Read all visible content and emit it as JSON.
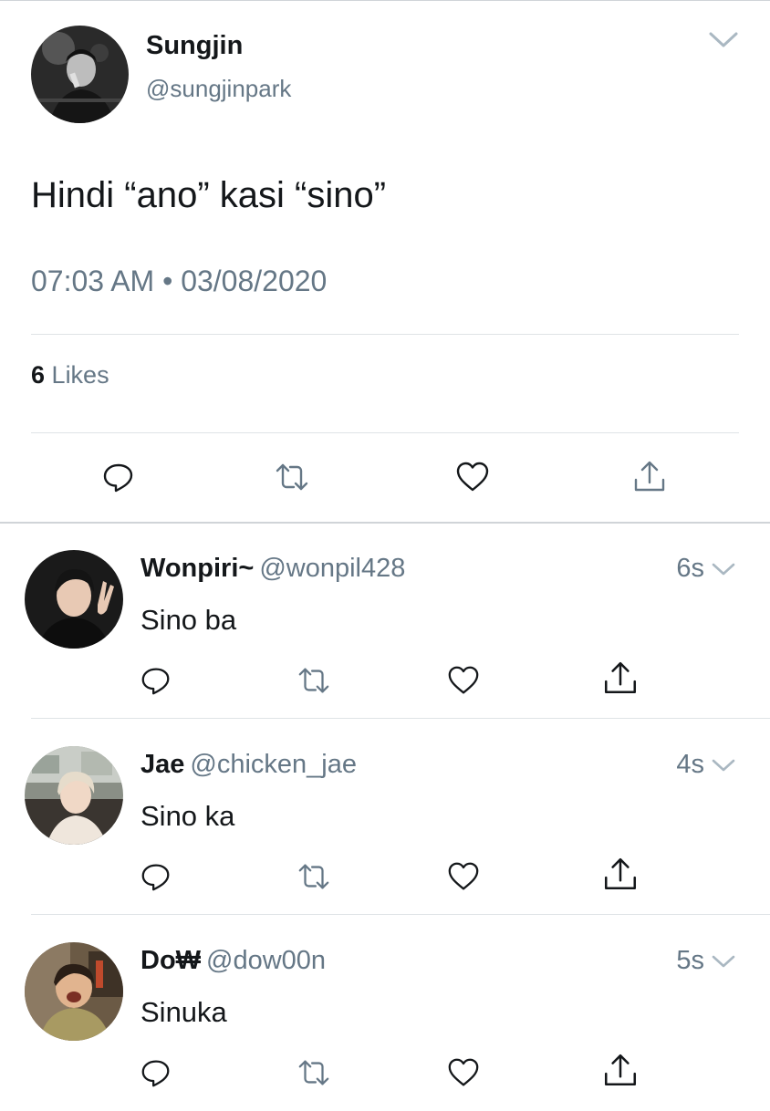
{
  "main_tweet": {
    "name": "Sungjin",
    "handle": "@sungjinpark",
    "text": "Hindi “ano” kasi “sino”",
    "timestamp": "07:03 AM • 03/08/2020",
    "likes_count": "6",
    "likes_label": "Likes"
  },
  "replies": [
    {
      "name": "Wonpiri~",
      "handle": "@wonpil428",
      "time": "6s",
      "text": "Sino ba"
    },
    {
      "name": "Jae",
      "handle": "@chicken_jae",
      "time": "4s",
      "text": "Sino ka"
    },
    {
      "name": "Do₩",
      "handle": "@dow00n",
      "time": "5s",
      "text": "Sinuka"
    }
  ],
  "icons": [
    "reply-icon",
    "retweet-icon",
    "like-icon",
    "share-icon",
    "chevron-down-icon"
  ],
  "colors": {
    "text": "#14171a",
    "secondary": "#657786",
    "divider": "#dfe3e6"
  }
}
